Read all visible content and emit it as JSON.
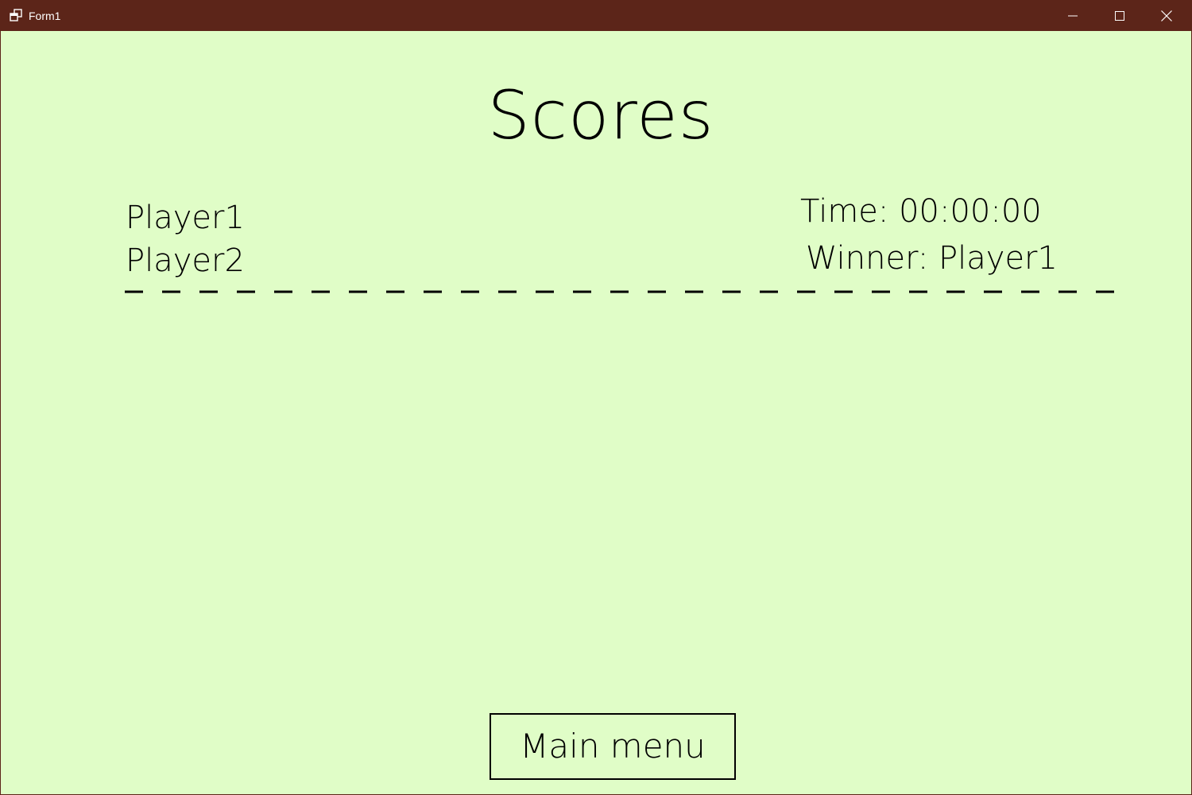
{
  "window": {
    "title": "Form1",
    "icon": "form-window-icon",
    "controls": {
      "minimize_icon": "minimize-icon",
      "maximize_icon": "maximize-icon",
      "close_icon": "close-icon"
    },
    "colors": {
      "titlebar": "#5c2519",
      "background": "#e0fdc7",
      "text": "#000000"
    }
  },
  "scores": {
    "title": "Scores",
    "players": [
      "Player1",
      "Player2"
    ],
    "time_text": "Time: 00:00:00",
    "winner_text": "Winner: Player1"
  },
  "buttons": {
    "main_menu": "Main menu"
  }
}
